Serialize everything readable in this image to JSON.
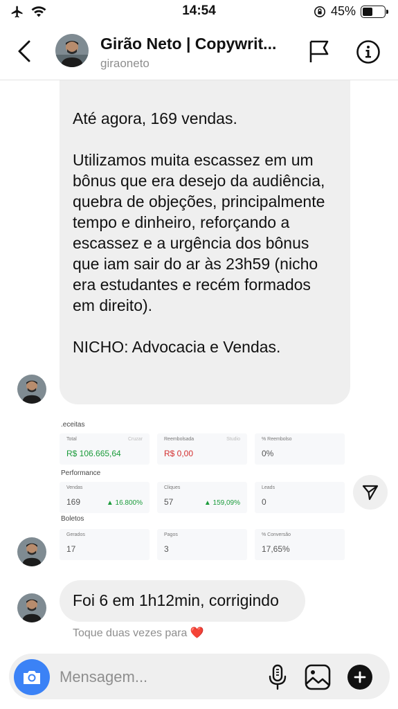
{
  "status_bar": {
    "time": "14:54",
    "battery": "45%",
    "battery_level": 0.45
  },
  "header": {
    "name": "Girão Neto | Copywrit...",
    "username": "giraoneto"
  },
  "messages": {
    "long_paragraphs": [
      "Até agora, 169 vendas.",
      "Utilizamos muita escassez em um bônus que era desejo da audiência, quebra de objeções, principalmente tempo e dinheiro, reforçando a escassez e a urgência dos bônus que iam sair do ar às 23h59 (nicho era estudantes e recém formados em direito).",
      "NICHO: Advocacia e Vendas."
    ],
    "short": "Foi 6 em 1h12min, corrigindo",
    "reaction_hint": "Toque duas vezes para",
    "reaction_emoji": "❤️"
  },
  "dashboard": {
    "receitas": {
      "title": ".eceitas",
      "total_label": "Total",
      "total_sub": "Cruzar",
      "total_value": "R$ 106.665,64",
      "reembolsada_label": "Reembolsada",
      "reembolsada_sub": "Studio",
      "reembolsada_value": "R$ 0,00",
      "pct_reembolso_label": "% Reembolso",
      "pct_reembolso_value": "0%"
    },
    "performance": {
      "title": "Performance",
      "vendas_label": "Vendas",
      "vendas_value": "169",
      "vendas_trend": "▲ 16.800%",
      "cliques_label": "Cliques",
      "cliques_value": "57",
      "cliques_trend": "▲ 159,09%",
      "leads_label": "Leads",
      "leads_value": "0"
    },
    "boletos": {
      "title": "Boletos",
      "gerados_label": "Gerados",
      "gerados_value": "17",
      "pagos_label": "Pagos",
      "pagos_value": "3",
      "conversao_label": "% Conversão",
      "conversao_value": "17,65%"
    }
  },
  "composer": {
    "placeholder": "Mensagem..."
  }
}
